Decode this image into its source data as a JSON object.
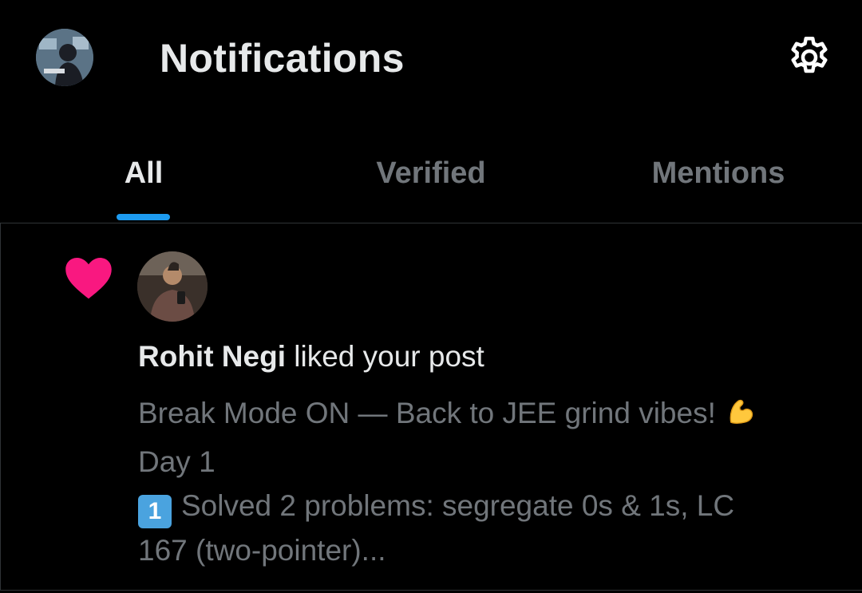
{
  "header": {
    "title": "Notifications",
    "avatar_icon": "user-avatar-icon",
    "settings_icon": "gear-icon"
  },
  "tabs": [
    {
      "label": "All",
      "active": true
    },
    {
      "label": "Verified",
      "active": false
    },
    {
      "label": "Mentions",
      "active": false
    }
  ],
  "colors": {
    "background": "#000000",
    "text_primary": "#e7e9ea",
    "text_secondary": "#71767b",
    "accent": "#1d9bf0",
    "like": "#f91880",
    "divider": "#2f3336"
  },
  "notification": {
    "type_icon": "heart-icon",
    "user_name": "Rohit Negi",
    "action_text": " liked your post",
    "post_lines": [
      "Break Mode ON — Back to JEE grind vibes! ",
      "Day 1",
      "Solved 2 problems: segregate 0s & 1s, LC",
      "167 (two-pointer)..."
    ],
    "keycap": "1"
  }
}
